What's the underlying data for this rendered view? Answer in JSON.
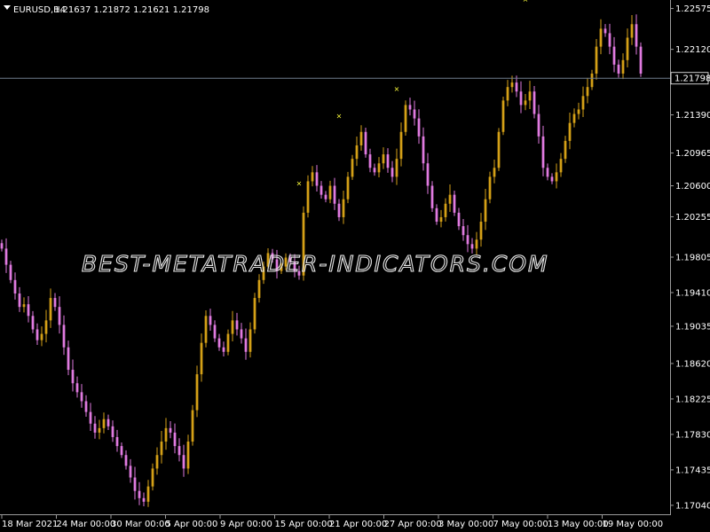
{
  "header": {
    "symbol": "EURUSD,H4",
    "ohlc": "1.21637 1.21872 1.21621 1.21798",
    "dropdown_icon": "triangle-down-icon"
  },
  "watermark": "BEST-METATRADER-INDICATORS.COM",
  "price_line": {
    "value": 1.21798,
    "label": "1.21798"
  },
  "chart_data": {
    "type": "candlestick",
    "x_ticks": [
      "18 Mar 2021",
      "24 Mar 00:00",
      "30 Mar 00:00",
      "5 Apr 00:00",
      "9 Apr 00:00",
      "15 Apr 00:00",
      "21 Apr 00:00",
      "27 Apr 00:00",
      "3 May 00:00",
      "7 May 00:00",
      "13 May 00:00",
      "19 May 00:00"
    ],
    "y_ticks": [
      "1.22575",
      "1.22120",
      "1.21390",
      "1.20965",
      "1.20600",
      "1.20255",
      "1.19805",
      "1.19410",
      "1.19035",
      "1.18620",
      "1.18225",
      "1.17830",
      "1.17435",
      "1.17040"
    ],
    "y_range": [
      1.1696,
      1.2265
    ],
    "x_range": [
      0,
      150
    ],
    "x_tick_positions": [
      0,
      12.3,
      24.6,
      36.9,
      49.2,
      61.5,
      73.8,
      86.1,
      98.4,
      110.7,
      123,
      135.3
    ],
    "colors": {
      "bull": "#d4a017",
      "bear": "#e07ae0",
      "marker": "#ffff3c",
      "price_line": "#6f7d8c",
      "grid": "#9a9a9a"
    },
    "closes": [
      1.199,
      1.1972,
      1.1955,
      1.194,
      1.1925,
      1.1928,
      1.1915,
      1.19,
      1.1888,
      1.1895,
      1.191,
      1.1935,
      1.1925,
      1.1905,
      1.188,
      1.1855,
      1.184,
      1.183,
      1.182,
      1.1808,
      1.1795,
      1.1785,
      1.179,
      1.18,
      1.1792,
      1.178,
      1.177,
      1.176,
      1.1748,
      1.1735,
      1.172,
      1.1712,
      1.1708,
      1.1725,
      1.1745,
      1.176,
      1.1775,
      1.179,
      1.1785,
      1.177,
      1.176,
      1.1745,
      1.1775,
      1.181,
      1.185,
      1.1885,
      1.1915,
      1.1905,
      1.189,
      1.188,
      1.1875,
      1.1895,
      1.191,
      1.19,
      1.189,
      1.1875,
      1.19,
      1.1935,
      1.1955,
      1.197,
      1.1985,
      1.1978,
      1.1965,
      1.197,
      1.198,
      1.1975,
      1.1965,
      1.196,
      1.203,
      1.2065,
      1.2075,
      1.206,
      1.205,
      1.2045,
      1.206,
      1.204,
      1.2025,
      1.2045,
      1.207,
      1.209,
      1.2105,
      1.212,
      1.2095,
      1.208,
      1.2075,
      1.2085,
      1.2095,
      1.208,
      1.207,
      1.209,
      1.212,
      1.215,
      1.2145,
      1.2135,
      1.2115,
      1.2085,
      1.206,
      1.2035,
      1.202,
      1.2025,
      1.204,
      1.205,
      1.203,
      1.2015,
      1.2005,
      1.1995,
      1.199,
      1.2,
      1.202,
      1.2045,
      1.207,
      1.208,
      1.212,
      1.2155,
      1.217,
      1.2175,
      1.2165,
      1.215,
      1.2155,
      1.2165,
      1.214,
      1.2115,
      1.208,
      1.207,
      1.2065,
      1.2075,
      1.209,
      1.211,
      1.213,
      1.214,
      1.2145,
      1.216,
      1.217,
      1.2185,
      1.2215,
      1.2235,
      1.223,
      1.2215,
      1.2195,
      1.2185,
      1.22,
      1.2225,
      1.224,
      1.2215,
      1.2185
    ],
    "markers": [
      {
        "index": 67,
        "price": 1.2063
      },
      {
        "index": 76,
        "price": 1.2138
      },
      {
        "index": 89,
        "price": 1.2168
      },
      {
        "index": 118,
        "price": 1.2268
      }
    ]
  }
}
